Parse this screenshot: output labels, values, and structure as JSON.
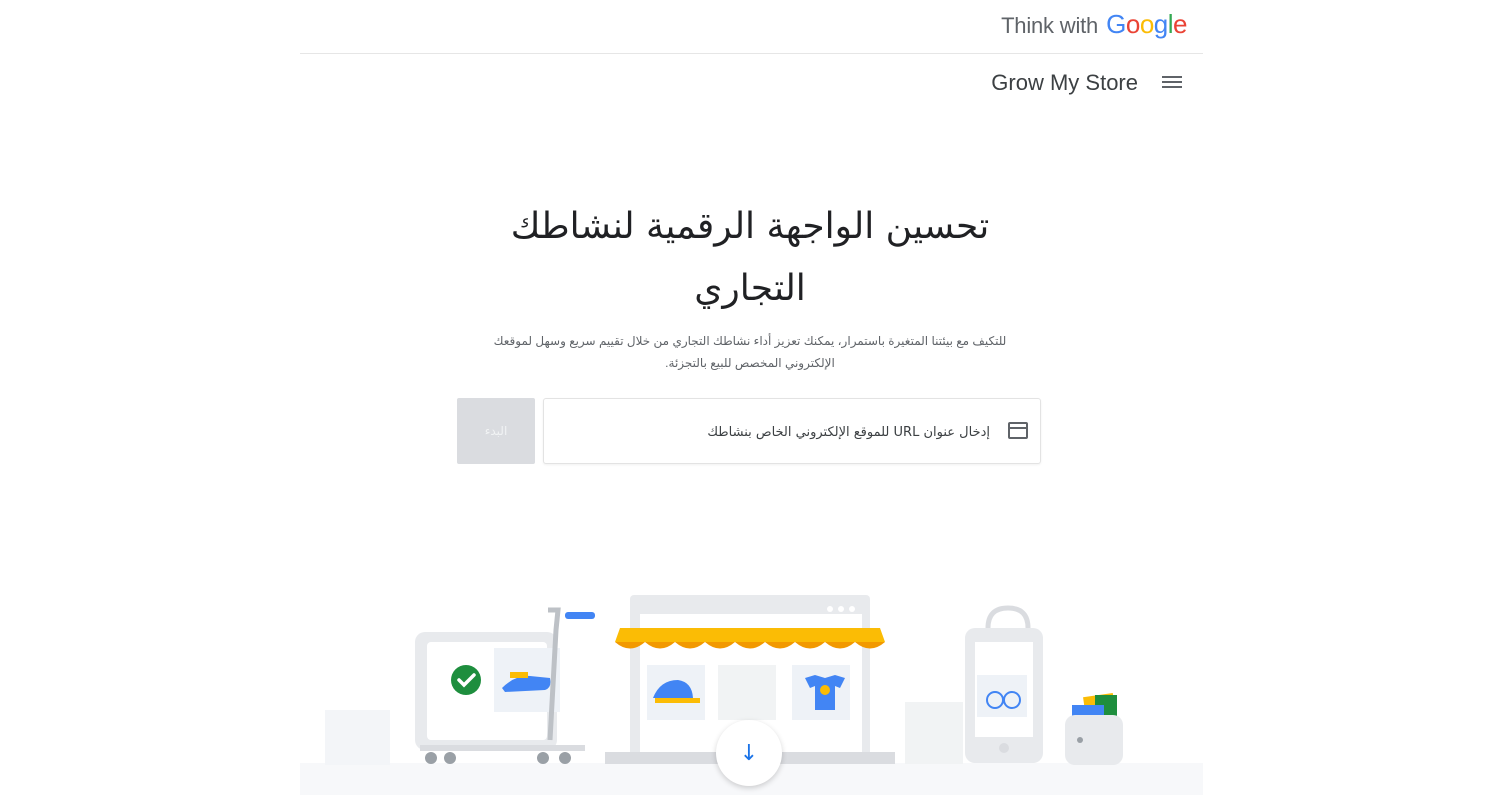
{
  "header": {
    "brand_prefix": "Think with",
    "brand_logo_letters": [
      {
        "ch": "G",
        "color": "#4285F4"
      },
      {
        "ch": "o",
        "color": "#EA4335"
      },
      {
        "ch": "o",
        "color": "#FBBC05"
      },
      {
        "ch": "g",
        "color": "#4285F4"
      },
      {
        "ch": "l",
        "color": "#34A853"
      },
      {
        "ch": "e",
        "color": "#EA4335"
      }
    ]
  },
  "nav": {
    "title": "Grow My Store",
    "menu_icon": "hamburger-menu-icon"
  },
  "hero": {
    "title": "تحسين الواجهة الرقمية لنشاطك التجاري",
    "subtitle": "للتكيف مع بيئتنا المتغيرة باستمرار، يمكنك تعزيز أداء نشاطك التجاري من خلال تقييم سريع وسهل لموقعك الإلكتروني المخصص للبيع بالتجزئة."
  },
  "url_form": {
    "placeholder": "إدخال عنوان URL للموقع الإلكتروني الخاص بنشاطك",
    "value": "",
    "button_label": "البدء",
    "input_icon": "browser-window-icon"
  },
  "illustration": {
    "scroll_icon": "arrow-down-icon",
    "colors": {
      "awning_yellow": "#FBBC05",
      "awning_orange": "#F29900",
      "check_green": "#1E8E3E",
      "accent_blue": "#4285F4"
    }
  }
}
